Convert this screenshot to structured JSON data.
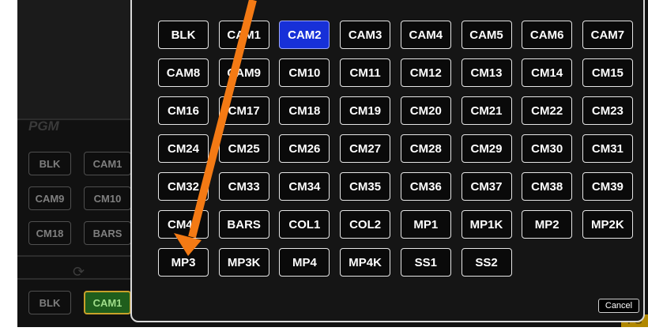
{
  "background": {
    "pgm_label": "PGM",
    "buttons": [
      "BLK",
      "CAM1",
      "CAM9",
      "CM10",
      "CM18",
      "BARS",
      "BLK",
      "CAM1"
    ]
  },
  "dialog": {
    "sources": [
      "BLK",
      "CAM1",
      "CAM2",
      "CAM3",
      "CAM4",
      "CAM5",
      "CAM6",
      "CAM7",
      "CAM8",
      "CAM9",
      "CM10",
      "CM11",
      "CM12",
      "CM13",
      "CM14",
      "CM15",
      "CM16",
      "CM17",
      "CM18",
      "CM19",
      "CM20",
      "CM21",
      "CM22",
      "CM23",
      "CM24",
      "CM25",
      "CM26",
      "CM27",
      "CM28",
      "CM29",
      "CM30",
      "CM31",
      "CM32",
      "CM33",
      "CM34",
      "CM35",
      "CM36",
      "CM37",
      "CM38",
      "CM39",
      "CM40",
      "BARS",
      "COL1",
      "COL2",
      "MP1",
      "MP1K",
      "MP2",
      "MP2K",
      "MP3",
      "MP3K",
      "MP4",
      "MP4K",
      "SS1",
      "SS2"
    ],
    "selected": "CAM2",
    "cancel_label": "Cancel"
  },
  "colors": {
    "selected_bg": "#1730d8",
    "arrow": "#f47a14",
    "pgm_active_bg": "#1f5e1c"
  }
}
